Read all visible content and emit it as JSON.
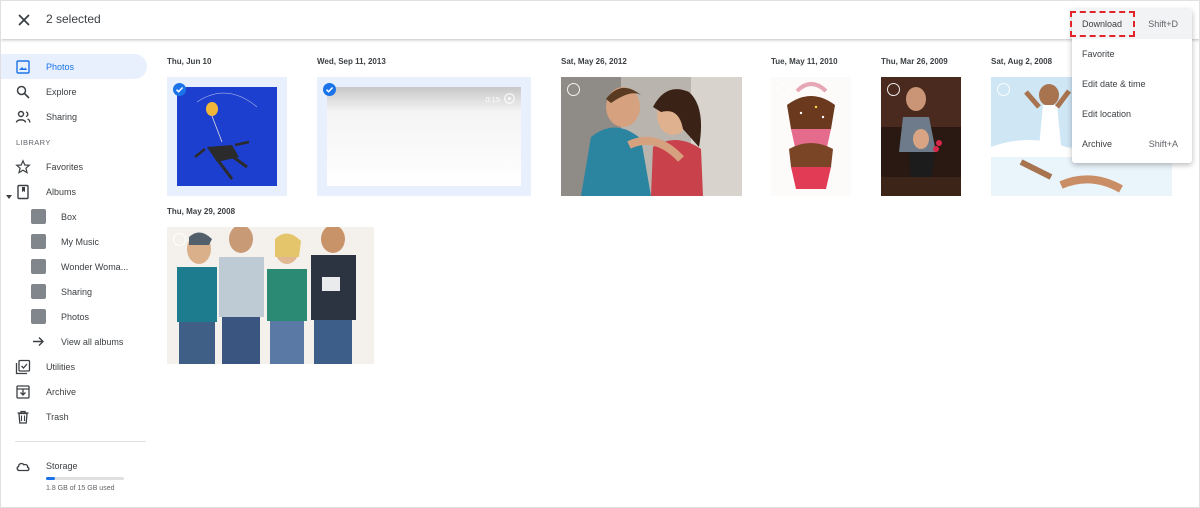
{
  "header": {
    "selected_text": "2 selected"
  },
  "sidebar": {
    "items": [
      {
        "label": "Photos",
        "icon": "photo-icon",
        "active": true
      },
      {
        "label": "Explore",
        "icon": "search-icon"
      },
      {
        "label": "Sharing",
        "icon": "people-icon"
      }
    ],
    "library_label": "LIBRARY",
    "library": [
      {
        "label": "Favorites",
        "icon": "star-icon"
      },
      {
        "label": "Albums",
        "icon": "album-icon"
      }
    ],
    "albums": [
      "Box",
      "My Music",
      "Wonder Woma...",
      "Sharing",
      "Photos"
    ],
    "view_all_albums": "View all albums",
    "more": [
      {
        "label": "Utilities",
        "icon": "utilities-icon"
      },
      {
        "label": "Archive",
        "icon": "archive-icon"
      },
      {
        "label": "Trash",
        "icon": "trash-icon"
      }
    ],
    "storage": {
      "label": "Storage",
      "used_text": "1.8 GB of 15 GB used",
      "used_fraction": 0.12
    }
  },
  "groups": [
    {
      "date": "Thu, Jun 10"
    },
    {
      "date": "Wed, Sep 11, 2013",
      "video_duration": "0:15"
    },
    {
      "date": "Sat, May 26, 2012"
    },
    {
      "date": "Tue, May 11, 2010"
    },
    {
      "date": "Thu, Mar 26, 2009"
    },
    {
      "date": "Sat, Aug 2, 2008"
    },
    {
      "date": "Thu, May 29, 2008"
    }
  ],
  "menu": {
    "items": [
      {
        "label": "Download",
        "shortcut": "Shift+D"
      },
      {
        "label": "Favorite",
        "shortcut": ""
      },
      {
        "label": "Edit date & time",
        "shortcut": ""
      },
      {
        "label": "Edit location",
        "shortcut": ""
      },
      {
        "label": "Archive",
        "shortcut": "Shift+A"
      }
    ]
  },
  "colors": {
    "accent": "#1a73e8",
    "selected_bg": "#e8f0fe",
    "highlight": "#e0242a"
  }
}
